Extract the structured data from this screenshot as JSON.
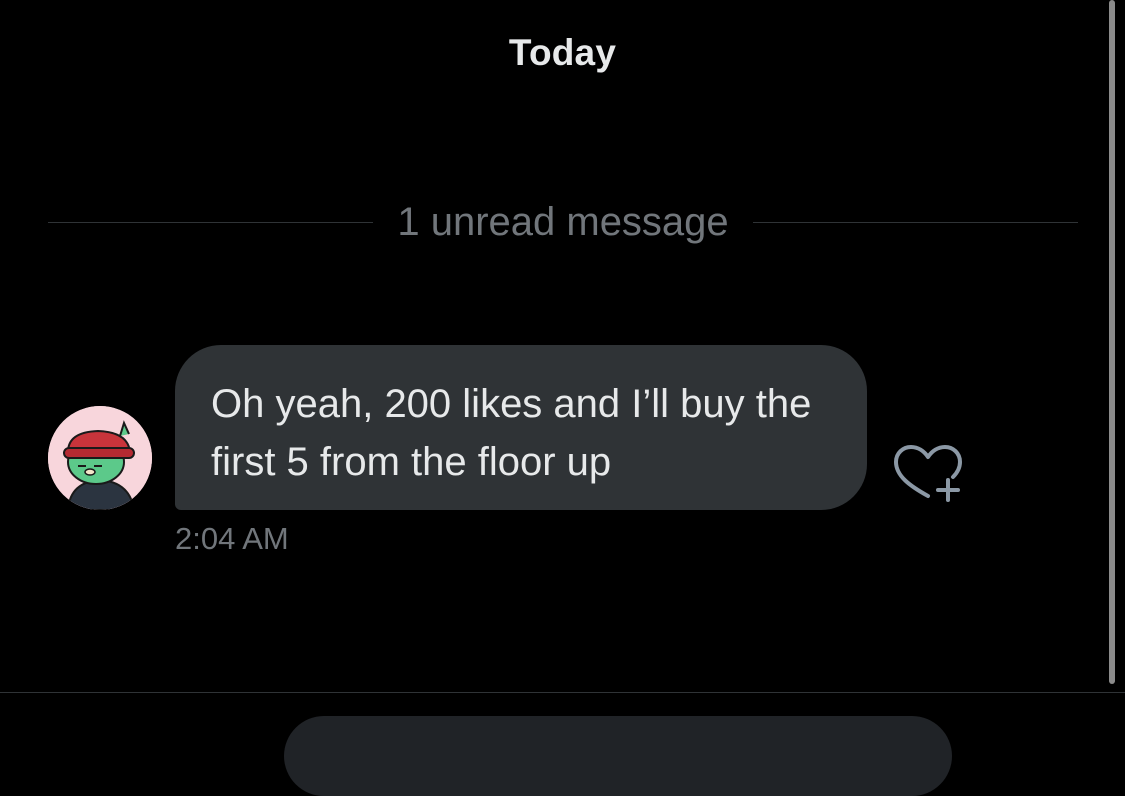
{
  "conversation": {
    "date_header": "Today",
    "unread_divider": "1 unread message"
  },
  "message": {
    "avatar_icon": "cartoon-character-avatar-icon",
    "text": "Oh yeah, 200 likes and I’ll buy the first 5 from the floor up",
    "timestamp": "2:04 AM",
    "reaction_icon": "heart-plus-icon"
  },
  "composer": {
    "input_value": ""
  },
  "colors": {
    "background": "#000000",
    "bubble": "#2f3336",
    "primary_text": "#e7e9ea",
    "secondary_text": "#71767b",
    "divider": "#2f3336",
    "avatar_background": "#f8d6dc"
  }
}
